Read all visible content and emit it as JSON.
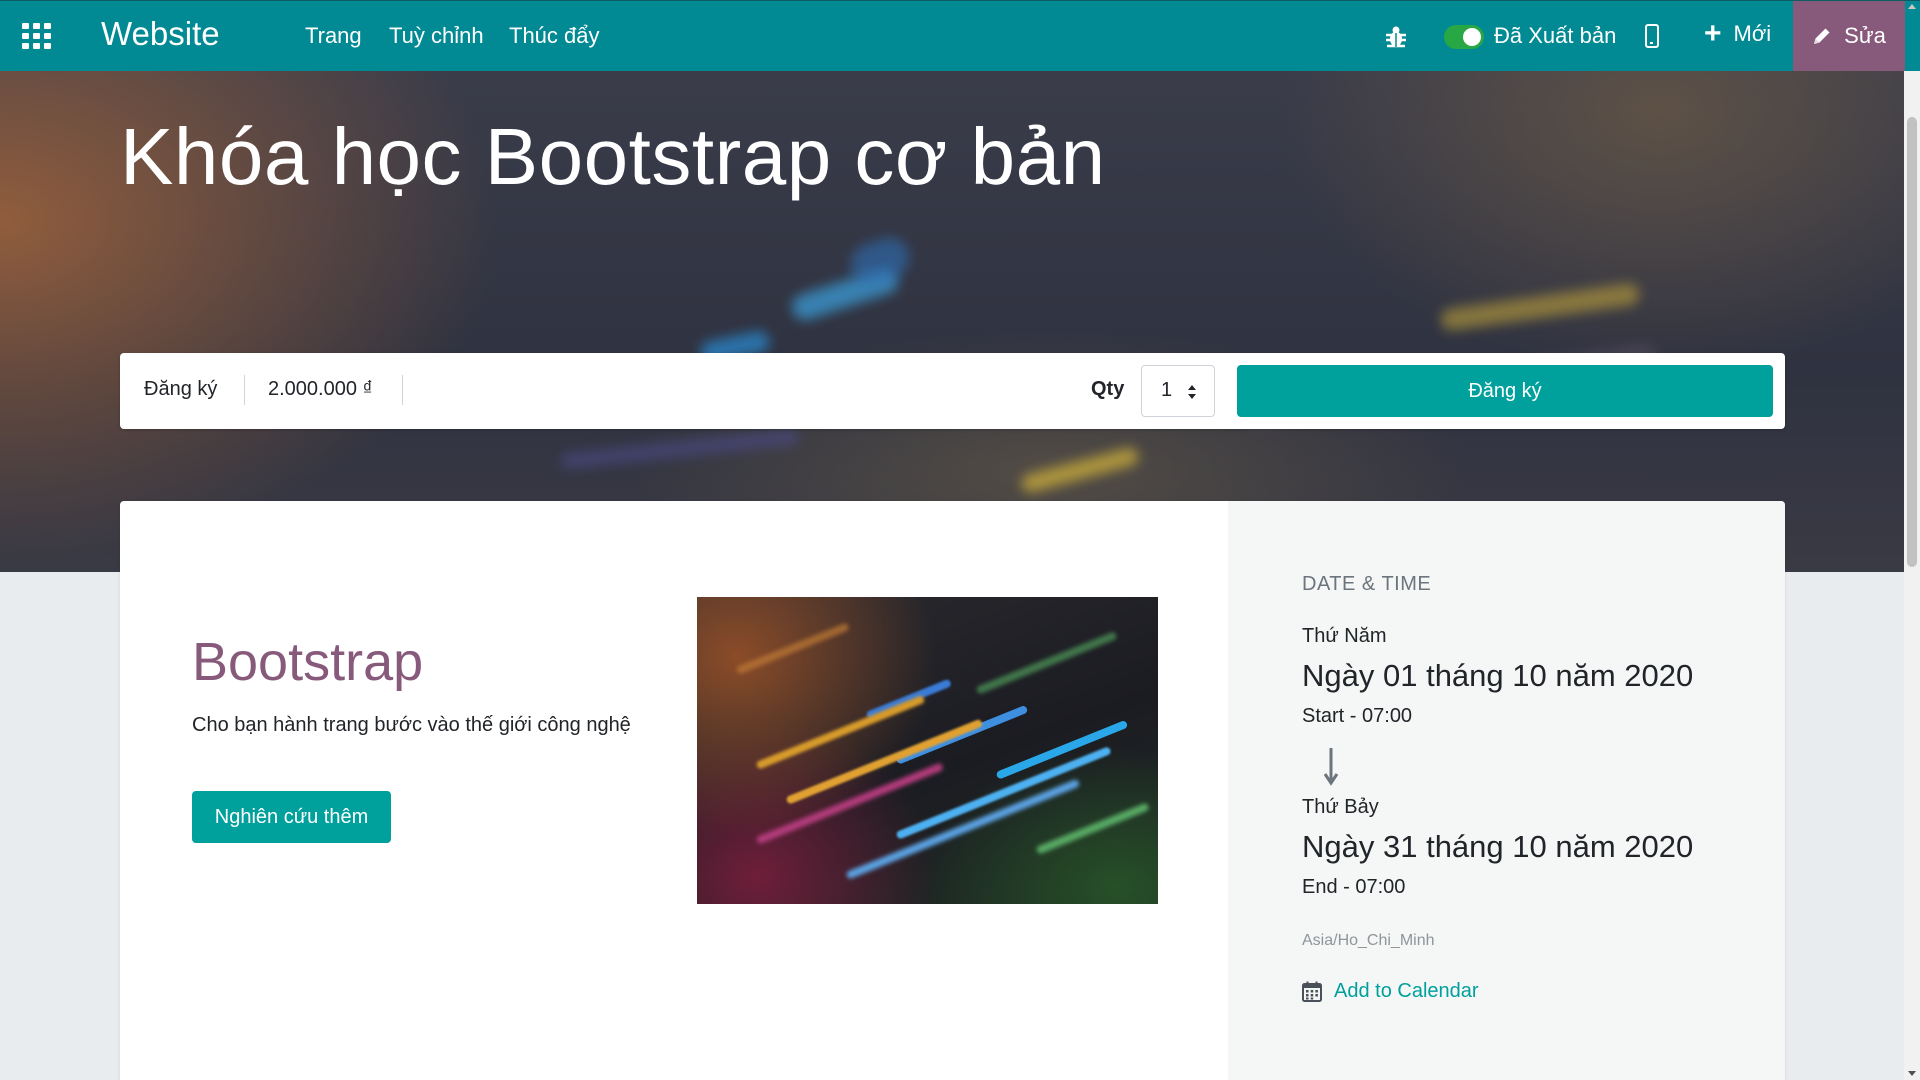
{
  "topbar": {
    "brand": "Website",
    "nav": [
      "Trang",
      "Tuỳ chỉnh",
      "Thúc đẩy"
    ],
    "published_label": "Đã Xuất bản",
    "new_label": "Mới",
    "edit_label": "Sửa",
    "color": "#018a93",
    "edit_color": "#875a7b"
  },
  "hero": {
    "title": "Khóa học Bootstrap cơ bản"
  },
  "register": {
    "label": "Đăng ký",
    "price": "2.000.000 ₫",
    "qty_label": "Qty",
    "qty_value": "1",
    "button": "Đăng ký",
    "accent": "#00a09d"
  },
  "content": {
    "title": "Bootstrap",
    "subtitle": "Cho bạn hành trang bước vào thế giới công nghệ",
    "learn_more": "Nghiên cứu thêm",
    "image_icon": "code-screen-image"
  },
  "sidebar": {
    "heading": "DATE & TIME",
    "start_day": "Thứ Năm",
    "start_date": "Ngày 01 tháng 10 năm 2020",
    "start_time": "Start - 07:00",
    "end_day": "Thứ Bảy",
    "end_date": "Ngày 31 tháng 10 năm 2020",
    "end_time": "End - 07:00",
    "timezone": "Asia/Ho_Chi_Minh",
    "add_calendar": "Add to Calendar"
  }
}
